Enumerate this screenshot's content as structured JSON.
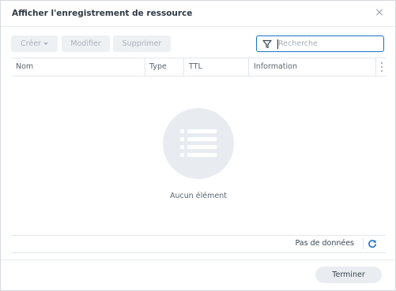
{
  "dialog": {
    "title": "Afficher l'enregistrement de ressource",
    "close_icon": "close-icon"
  },
  "toolbar": {
    "create_label": "Créer",
    "modify_label": "Modifier",
    "delete_label": "Supprimer"
  },
  "search": {
    "placeholder": "Recherche",
    "value": "",
    "icon": "filter-icon"
  },
  "table": {
    "columns": [
      "Nom",
      "Type",
      "TTL",
      "Information"
    ]
  },
  "empty_state": {
    "icon": "list-icon",
    "message": "Aucun élément"
  },
  "footer": {
    "status": "Pas de données",
    "refresh_icon": "refresh-icon"
  },
  "actions": {
    "finish_label": "Terminer"
  },
  "colors": {
    "accent": "#1a73c6",
    "disabled_button_bg": "#eef1f4",
    "empty_icon_bg": "#e8ecf1"
  }
}
